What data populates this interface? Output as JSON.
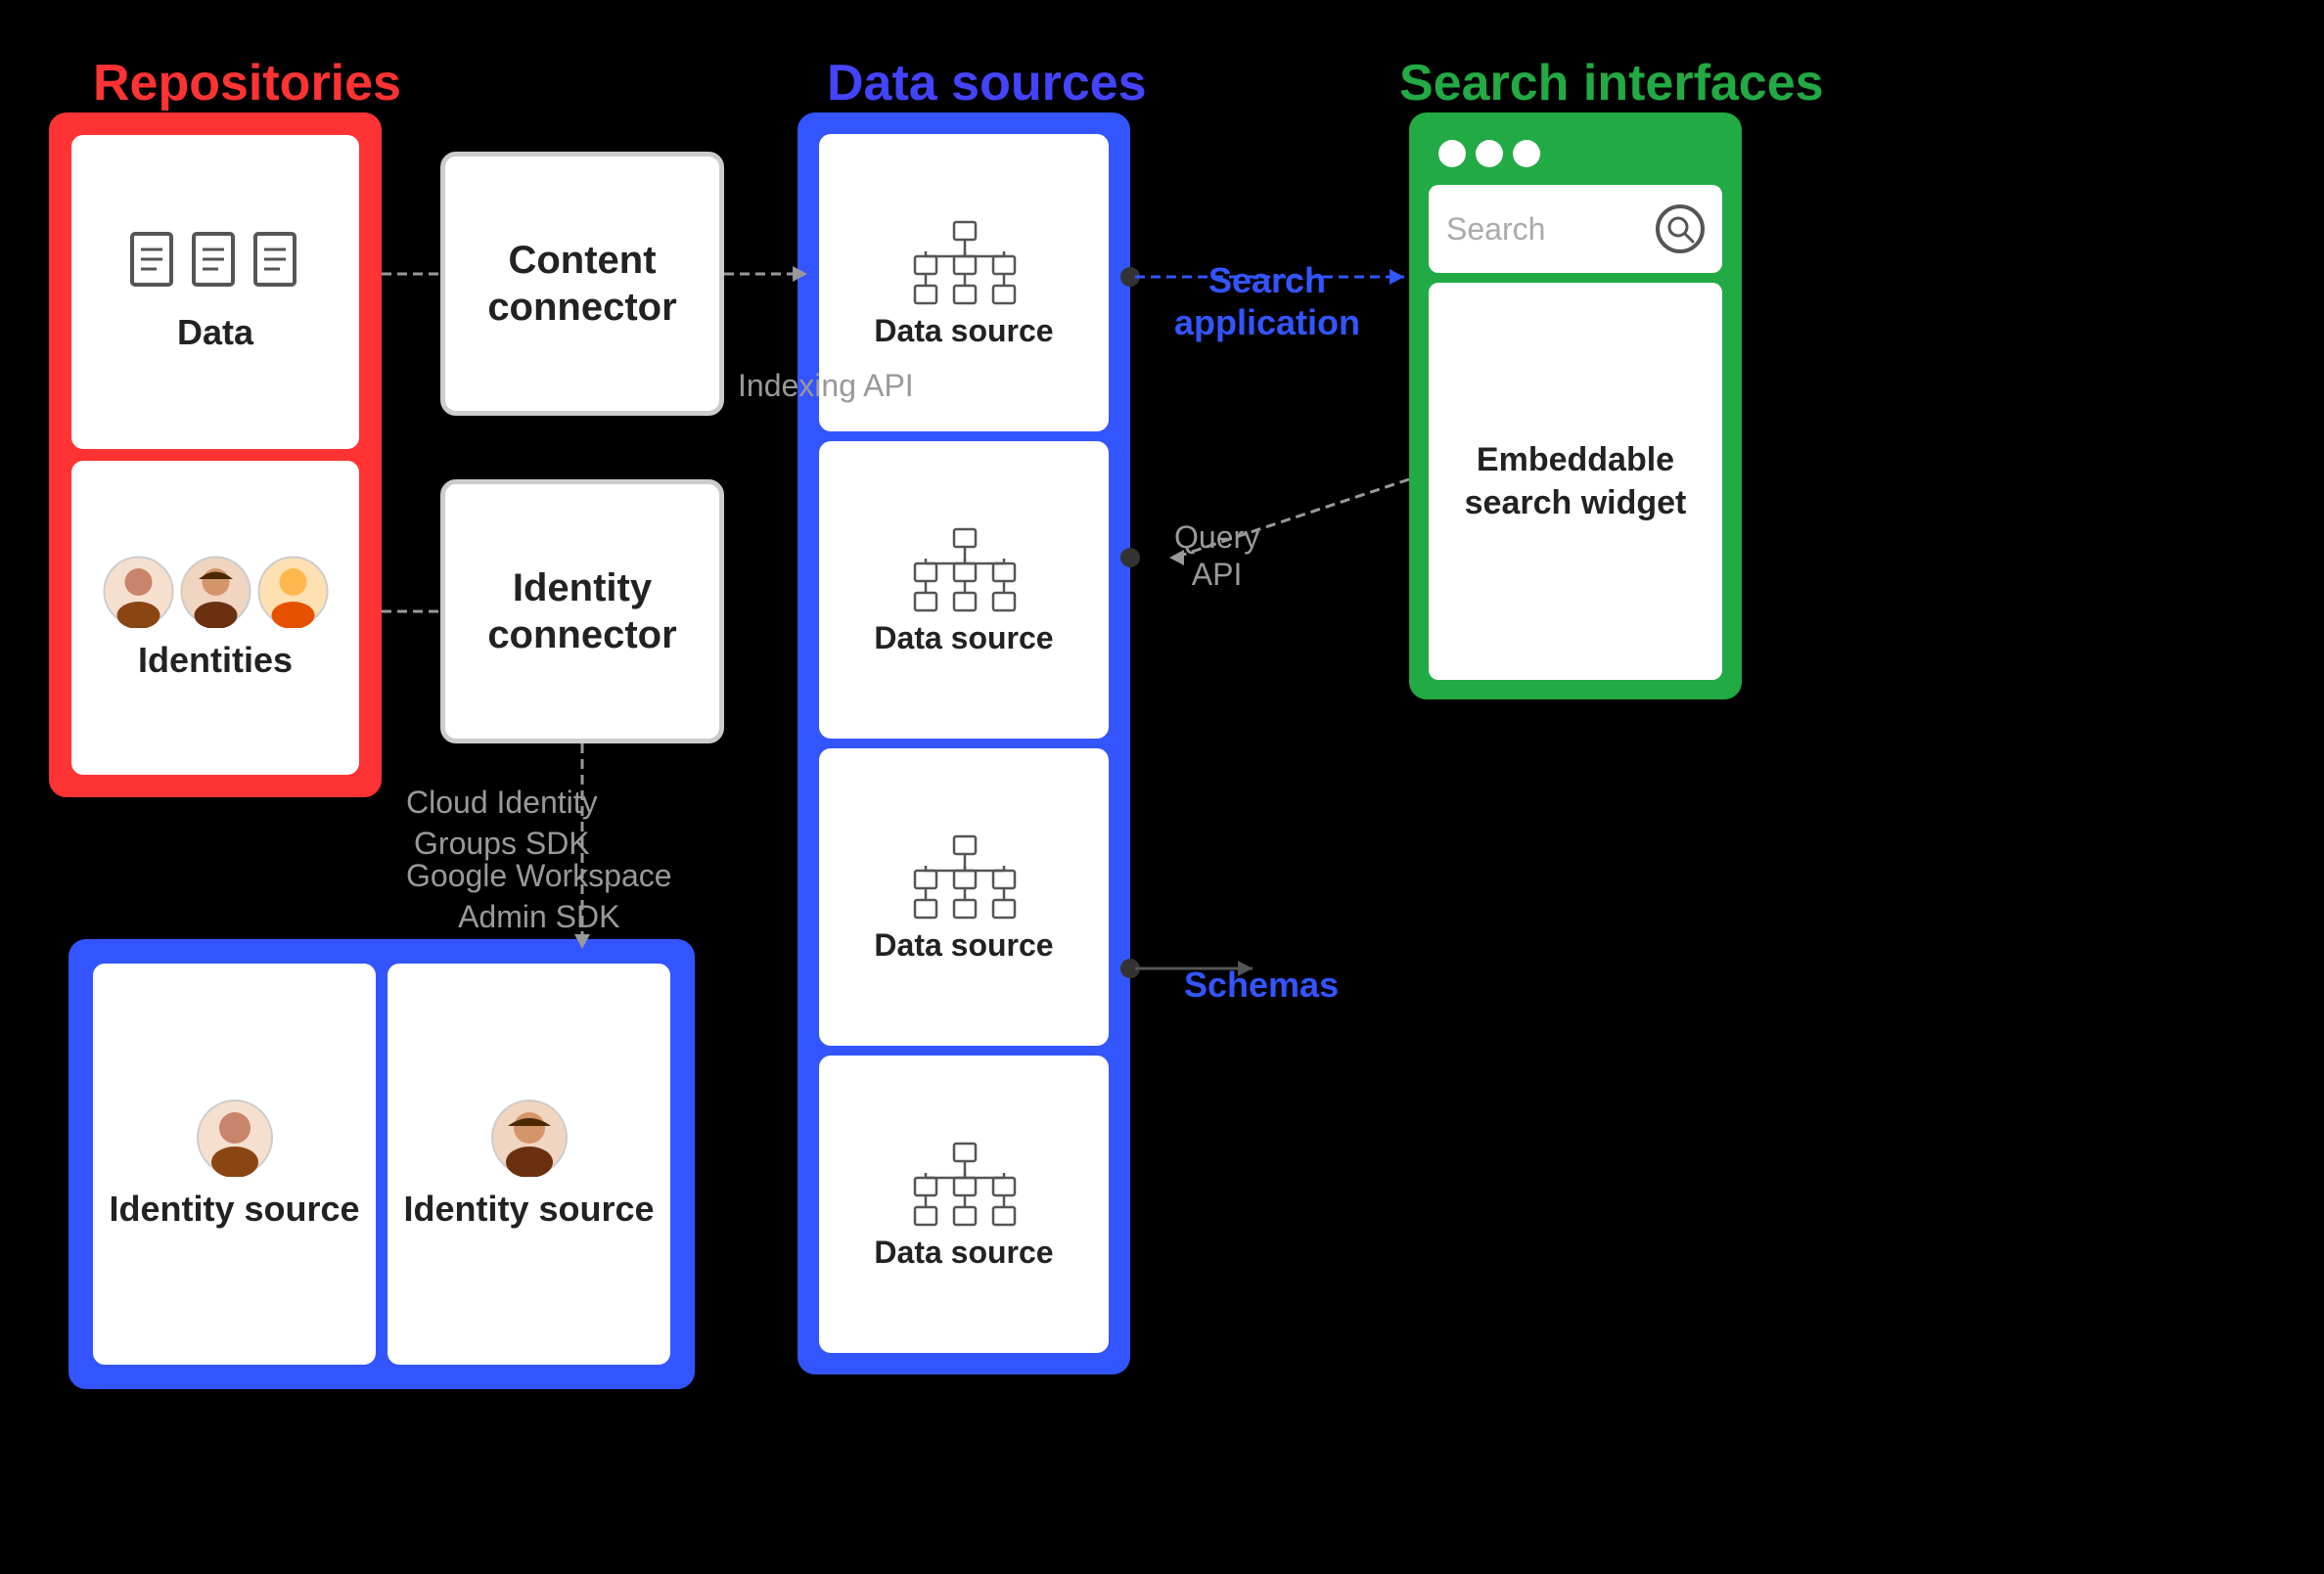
{
  "sections": {
    "repositories": {
      "label": "Repositories",
      "color": "#FF3333"
    },
    "data_sources": {
      "label": "Data sources",
      "color": "#3355FF"
    },
    "search_interfaces": {
      "label": "Search interfaces",
      "color": "#22AA44"
    }
  },
  "repositories": {
    "data_box_label": "Data",
    "identities_box_label": "Identities"
  },
  "connectors": {
    "content_connector_label": "Content connector",
    "identity_connector_label": "Identity connector"
  },
  "data_sources": {
    "items": [
      {
        "label": "Data source"
      },
      {
        "label": "Data source"
      },
      {
        "label": "Data source"
      },
      {
        "label": "Data source"
      }
    ]
  },
  "identity_sources": {
    "items": [
      {
        "label": "Identity source"
      },
      {
        "label": "Identity source"
      }
    ]
  },
  "search_interface": {
    "dots": 3,
    "search_placeholder": "Search",
    "widget_label": "Embeddable search widget"
  },
  "labels": {
    "indexing_api": "Indexing API",
    "cloud_identity": "Cloud Identity\nGroups SDK",
    "google_workspace": "Google Workspace\nAdmin SDK",
    "search_application": "Search\napplication",
    "query_api": "Query\nAPI",
    "schemas": "Schemas"
  }
}
